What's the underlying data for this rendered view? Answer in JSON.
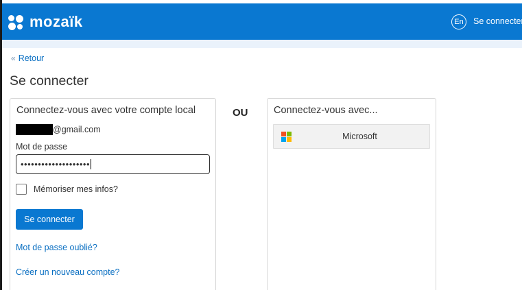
{
  "header": {
    "brand": "mozaïk",
    "language": "En",
    "login_label": "Se connecter"
  },
  "nav": {
    "back_label": "Retour"
  },
  "page": {
    "title": "Se connecter"
  },
  "local_login": {
    "heading": "Connectez-vous avec votre compte local",
    "email_suffix": "@gmail.com",
    "password_label": "Mot de passe",
    "password_value": "••••••••••••••••••••",
    "remember_label": "Mémoriser mes infos?",
    "submit_label": "Se connecter",
    "forgot_label": "Mot de passe oublié?",
    "create_label": "Créer un nouveau compte?"
  },
  "separator": {
    "label": "OU"
  },
  "external_login": {
    "heading": "Connectez-vous avec...",
    "providers": [
      {
        "name": "Microsoft",
        "icon": "microsoft-logo-icon"
      }
    ]
  },
  "colors": {
    "brand_blue": "#0a78d1",
    "link_blue": "#0a6fc2",
    "ms_red": "#f25022",
    "ms_green": "#7fba00",
    "ms_blue": "#00a4ef",
    "ms_yellow": "#ffb900"
  }
}
